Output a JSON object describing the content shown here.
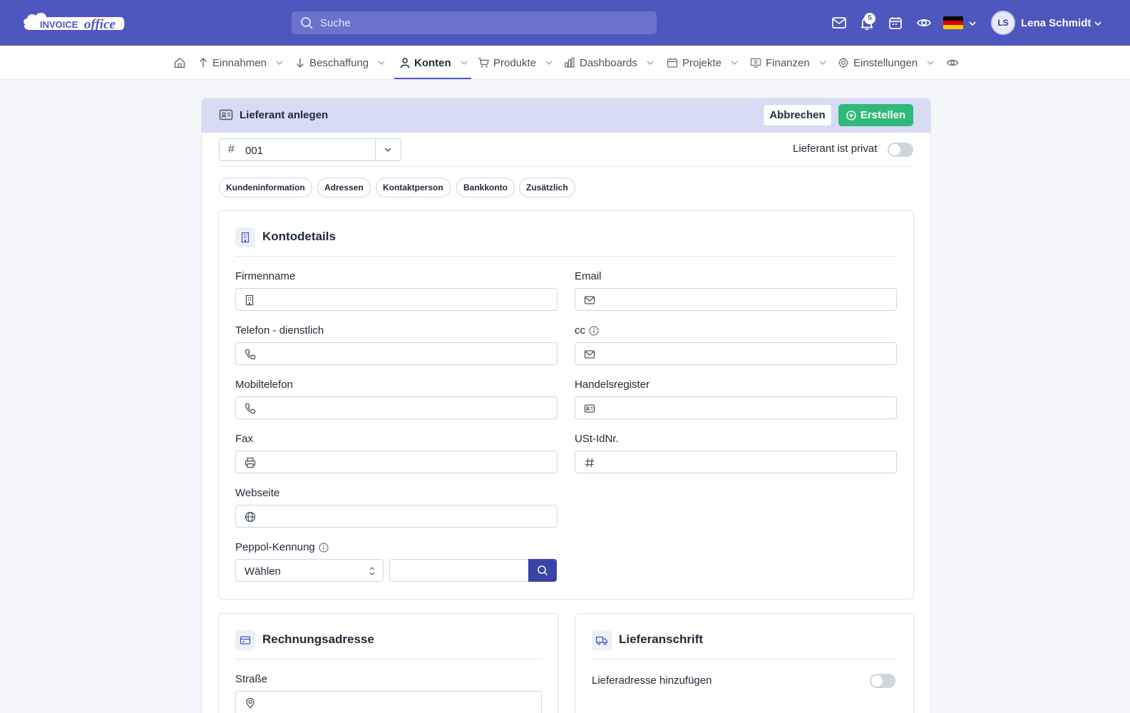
{
  "header": {
    "logo_text": "INVOICE office",
    "search_placeholder": "Suche",
    "notifications_count": "5",
    "user_initials": "LS",
    "user_name": "Lena Schmidt",
    "language_flag": "de-flag-icon",
    "icons": [
      "mail-icon",
      "bell-icon",
      "calendar-icon",
      "eye-icon"
    ]
  },
  "nav": {
    "items": [
      {
        "label": "Einnahmen",
        "icon": "arrow-up-icon"
      },
      {
        "label": "Beschaffung",
        "icon": "arrow-down-icon"
      },
      {
        "label": "Konten",
        "icon": "user-icon",
        "active": true
      },
      {
        "label": "Produkte",
        "icon": "cart-icon"
      },
      {
        "label": "Dashboards",
        "icon": "bar-chart-icon"
      },
      {
        "label": "Projekte",
        "icon": "calendar-icon"
      },
      {
        "label": "Finanzen",
        "icon": "monitor-icon"
      },
      {
        "label": "Einstellungen",
        "icon": "gear-icon"
      }
    ]
  },
  "form": {
    "title": "Lieferant anlegen",
    "cancel_label": "Abbrechen",
    "create_label": "Erstellen",
    "number_value": "001",
    "private_label": "Lieferant ist privat",
    "private_enabled": false,
    "tabs": [
      "Kundeninformation",
      "Adressen",
      "Kontaktperson",
      "Bankkonto",
      "Zusätzlich"
    ]
  },
  "kontodetails": {
    "title": "Kontodetails",
    "left_fields": [
      {
        "label": "Firmenname",
        "icon": "building-icon",
        "value": ""
      },
      {
        "label": "Telefon - dienstlich",
        "icon": "phone-icon",
        "value": ""
      },
      {
        "label": "Mobiltelefon",
        "icon": "phone-icon",
        "value": ""
      },
      {
        "label": "Fax",
        "icon": "printer-icon",
        "value": ""
      },
      {
        "label": "Webseite",
        "icon": "globe-icon",
        "value": ""
      }
    ],
    "right_fields": [
      {
        "label": "Email",
        "icon": "mail-icon",
        "value": ""
      },
      {
        "label": "cc",
        "icon": "mail-icon",
        "value": "",
        "info": true
      },
      {
        "label": "Handelsregister",
        "icon": "id-card-icon",
        "value": ""
      },
      {
        "label": "USt-IdNr.",
        "icon": "hash-icon",
        "value": ""
      }
    ],
    "peppol_label": "Peppol-Kennung",
    "peppol_select_value": "Wählen",
    "peppol_input_value": ""
  },
  "rechnungsadresse": {
    "title": "Rechnungsadresse",
    "street_label": "Straße"
  },
  "lieferanschrift": {
    "title": "Lieferanschrift",
    "add_label": "Lieferadresse hinzufügen",
    "add_enabled": false
  },
  "colors": {
    "brand": "#4e57be",
    "accent_green": "#2fb97b",
    "header_panel": "#d7dbf4",
    "search_button": "#3a44a8"
  }
}
